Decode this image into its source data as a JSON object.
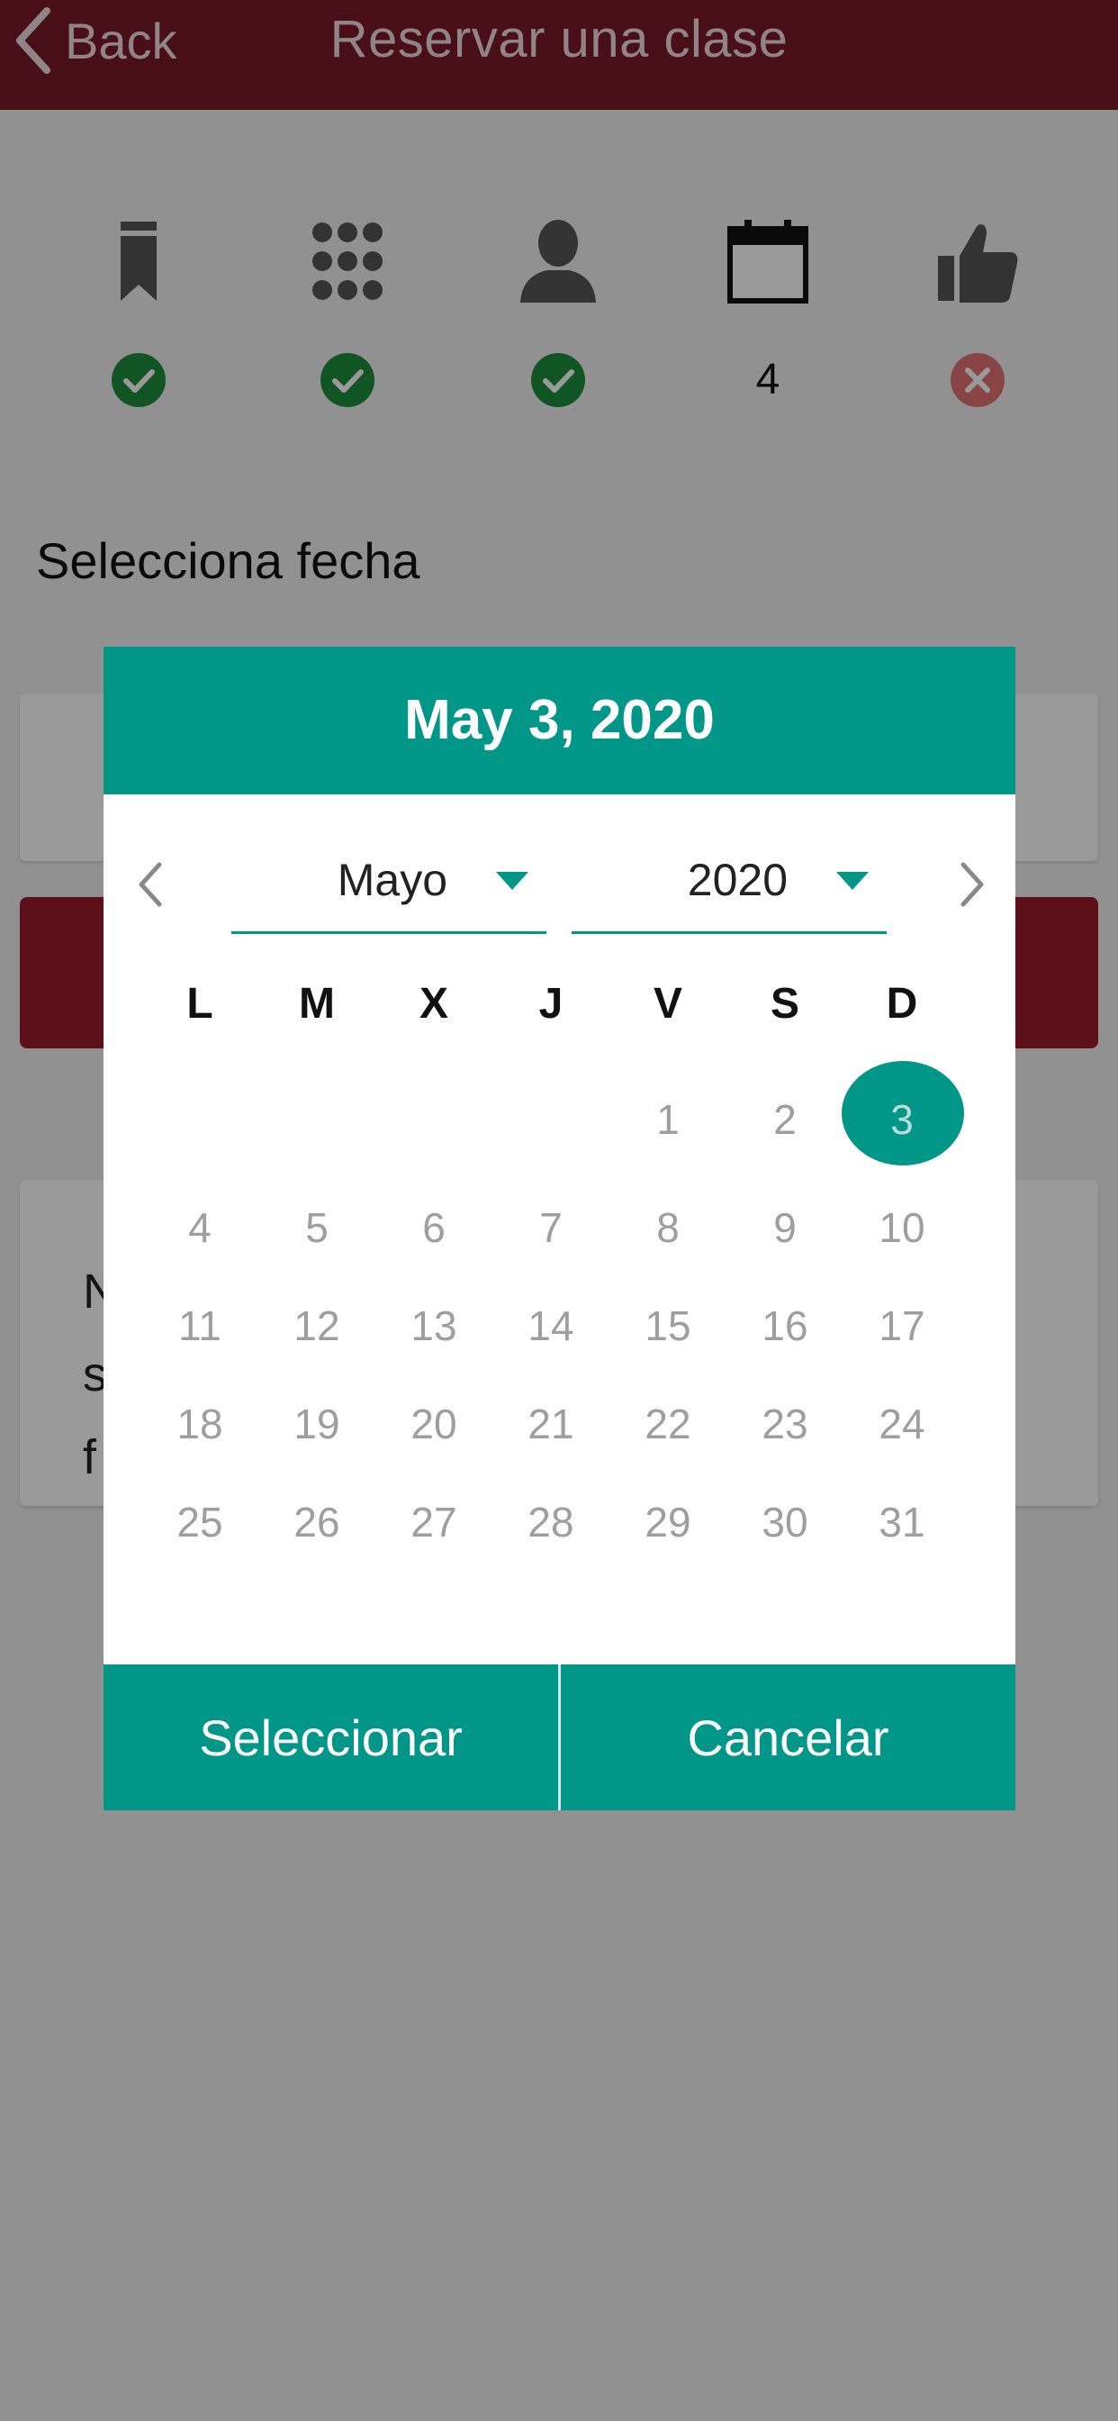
{
  "header": {
    "back_label": "Back",
    "title": "Reservar una clase"
  },
  "steps": [
    {
      "icon": "bookmark-icon",
      "status": "done"
    },
    {
      "icon": "grid-icon",
      "status": "done"
    },
    {
      "icon": "person-icon",
      "status": "done"
    },
    {
      "icon": "calendar-icon",
      "status": "current",
      "number": "4"
    },
    {
      "icon": "thumbs-up-icon",
      "status": "error"
    }
  ],
  "section_label": "Selecciona fecha",
  "background_card_text": "N\ns\nf",
  "dialog": {
    "header_date": "May 3, 2020",
    "month_value": "Mayo",
    "year_value": "2020",
    "weekdays": [
      "L",
      "M",
      "X",
      "J",
      "V",
      "S",
      "D"
    ],
    "weeks": [
      [
        "",
        "",
        "",
        "",
        "1",
        "2",
        "3"
      ],
      [
        "4",
        "5",
        "6",
        "7",
        "8",
        "9",
        "10"
      ],
      [
        "11",
        "12",
        "13",
        "14",
        "15",
        "16",
        "17"
      ],
      [
        "18",
        "19",
        "20",
        "21",
        "22",
        "23",
        "24"
      ],
      [
        "25",
        "26",
        "27",
        "28",
        "29",
        "30",
        "31"
      ]
    ],
    "selected_day": "3",
    "select_label": "Seleccionar",
    "cancel_label": "Cancelar"
  },
  "colors": {
    "header_bg": "#7a1a28",
    "accent": "#009688",
    "check_green": "#1e8e3e",
    "error_red": "#e57373",
    "button_red": "#9b1a2c"
  }
}
